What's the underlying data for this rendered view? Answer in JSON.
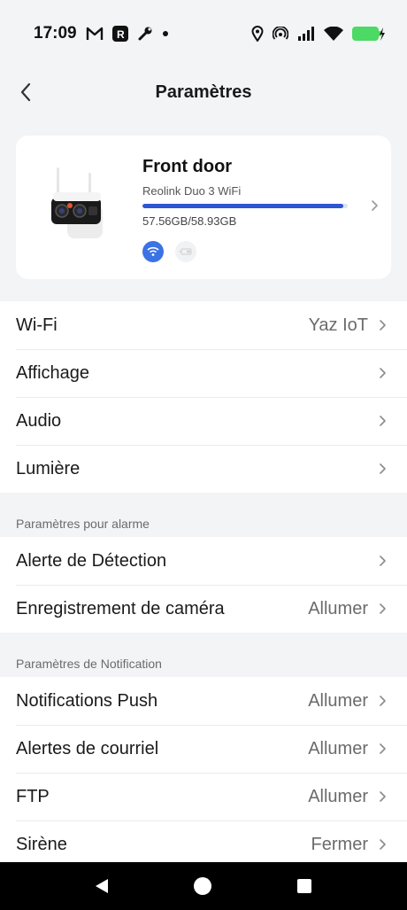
{
  "status_bar": {
    "time": "17:09",
    "left_icons": [
      "gmail-icon",
      "app-r-icon",
      "wrench-icon",
      "dot-icon"
    ],
    "right_icons": [
      "location-icon",
      "hotspot-icon",
      "signal-icon",
      "wifi-icon",
      "battery-charging-icon"
    ],
    "battery_color": "#4cd964"
  },
  "header": {
    "title": "Paramètres",
    "back_icon": "chevron-left-icon"
  },
  "device": {
    "name": "Front door",
    "model": "Reolink Duo 3 WiFi",
    "storage_text": "57.56GB/58.93GB",
    "storage_fraction": 0.977,
    "accent_color": "#2f55d4",
    "badges": [
      "wifi-icon",
      "battery-icon"
    ]
  },
  "group1": [
    {
      "label": "Wi-Fi",
      "value": "Yaz IoT"
    },
    {
      "label": "Affichage",
      "value": ""
    },
    {
      "label": "Audio",
      "value": ""
    },
    {
      "label": "Lumière",
      "value": ""
    }
  ],
  "section_alarm": "Paramètres pour alarme",
  "group2": [
    {
      "label": "Alerte de Détection",
      "value": ""
    },
    {
      "label": "Enregistrement de caméra",
      "value": "Allumer"
    }
  ],
  "section_notification": "Paramètres de Notification",
  "group3": [
    {
      "label": "Notifications Push",
      "value": "Allumer"
    },
    {
      "label": "Alertes de courriel",
      "value": "Allumer"
    },
    {
      "label": "FTP",
      "value": "Allumer"
    },
    {
      "label": "Sirène",
      "value": "Fermer"
    }
  ],
  "nav": {
    "buttons": [
      "back-triangle-icon",
      "home-circle-icon",
      "recents-square-icon"
    ]
  }
}
